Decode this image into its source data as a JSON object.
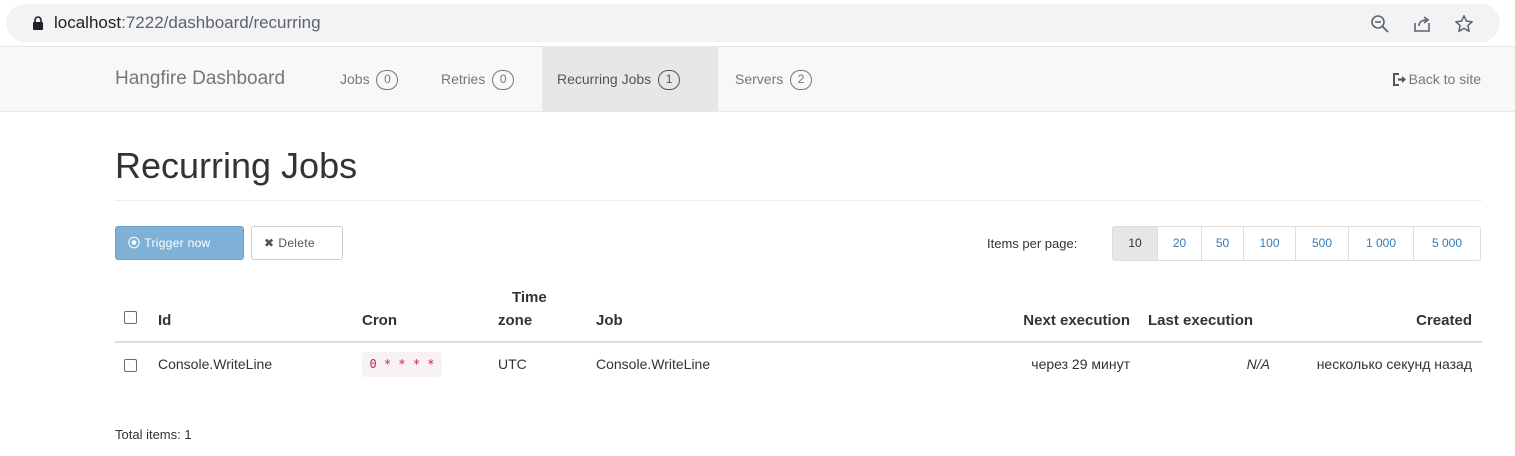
{
  "browser": {
    "url_host": "localhost",
    "url_rest": ":7222/dashboard/recurring",
    "icons": [
      "lock-icon",
      "zoom-icon",
      "share-icon",
      "bookmark-star-icon"
    ]
  },
  "navbar": {
    "brand": "Hangfire Dashboard",
    "items": [
      {
        "label": "Jobs",
        "count": "0"
      },
      {
        "label": "Retries",
        "count": "0"
      },
      {
        "label": "Recurring Jobs",
        "count": "1"
      },
      {
        "label": "Servers",
        "count": "2"
      }
    ],
    "back_label": "Back to site"
  },
  "page": {
    "title": "Recurring Jobs",
    "trigger_label": "Trigger now",
    "delete_label": "Delete",
    "items_per_page_label": "Items per page:",
    "page_sizes": [
      "10",
      "20",
      "50",
      "100",
      "500",
      "1 000",
      "5 000"
    ],
    "selected_page_size": "10",
    "total_label": "Total items: 1"
  },
  "table": {
    "headers": {
      "id": "Id",
      "cron": "Cron",
      "time_zone_line1": "Time",
      "time_zone_line2": "zone",
      "job": "Job",
      "next_execution": "Next execution",
      "last_execution": "Last execution",
      "created": "Created"
    },
    "rows": [
      {
        "id": "Console.WriteLine",
        "cron": "0 * * * *",
        "time_zone": "UTC",
        "job": "Console.WriteLine",
        "next_execution": "через 29 минут",
        "last_execution": "N/A",
        "created": "несколько секунд назад"
      }
    ]
  },
  "colors": {
    "primary_button": "#7fb0d6",
    "link": "#337ab7",
    "code_text": "#c7254e",
    "code_bg": "#f9f2f4",
    "navbar_bg": "#f8f8f8"
  }
}
